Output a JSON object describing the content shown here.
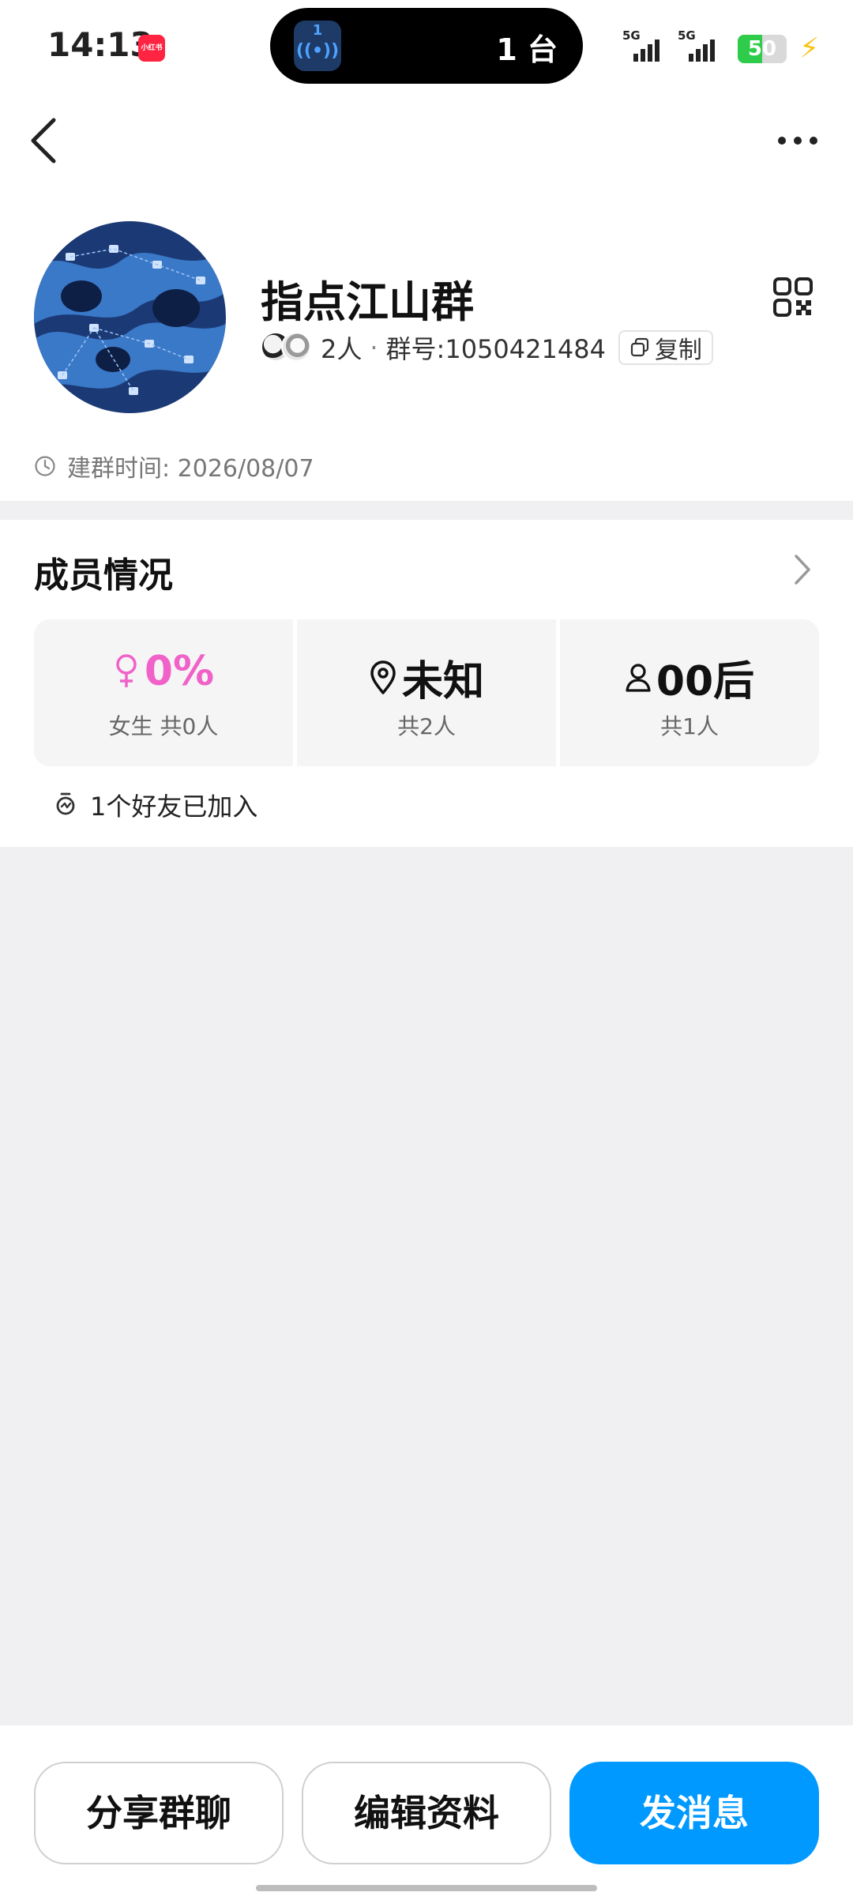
{
  "status_bar": {
    "time": "14:13",
    "app_badge": "小红书",
    "island_number": "1",
    "island_waves": "((•))",
    "island_text": "1 台",
    "signal_1_label": "5G",
    "signal_2_label": "5G",
    "battery_level": "50",
    "battery_fraction": 0.5,
    "battery_color": "#2ecc4a"
  },
  "group": {
    "name": "指点江山群",
    "member_count": "2人",
    "separator": "·",
    "group_id": "群号:1050421484",
    "copy_label": "复制",
    "created": "建群时间: 2026/08/07"
  },
  "members": {
    "title": "成员情况",
    "stats": [
      {
        "icon": "female-icon",
        "value": "0%",
        "sub": "女生 共0人",
        "color": "#f062c8"
      },
      {
        "icon": "location-icon",
        "value": "未知",
        "sub": "共2人",
        "color": "#111111"
      },
      {
        "icon": "person-icon",
        "value": "00后",
        "sub": "共1人",
        "color": "#111111"
      }
    ],
    "friends_joined": "1个好友已加入"
  },
  "actions": {
    "share": "分享群聊",
    "edit": "编辑资料",
    "send": "发消息"
  },
  "colors": {
    "primary": "#0099ff",
    "background": "#f0f0f2"
  }
}
